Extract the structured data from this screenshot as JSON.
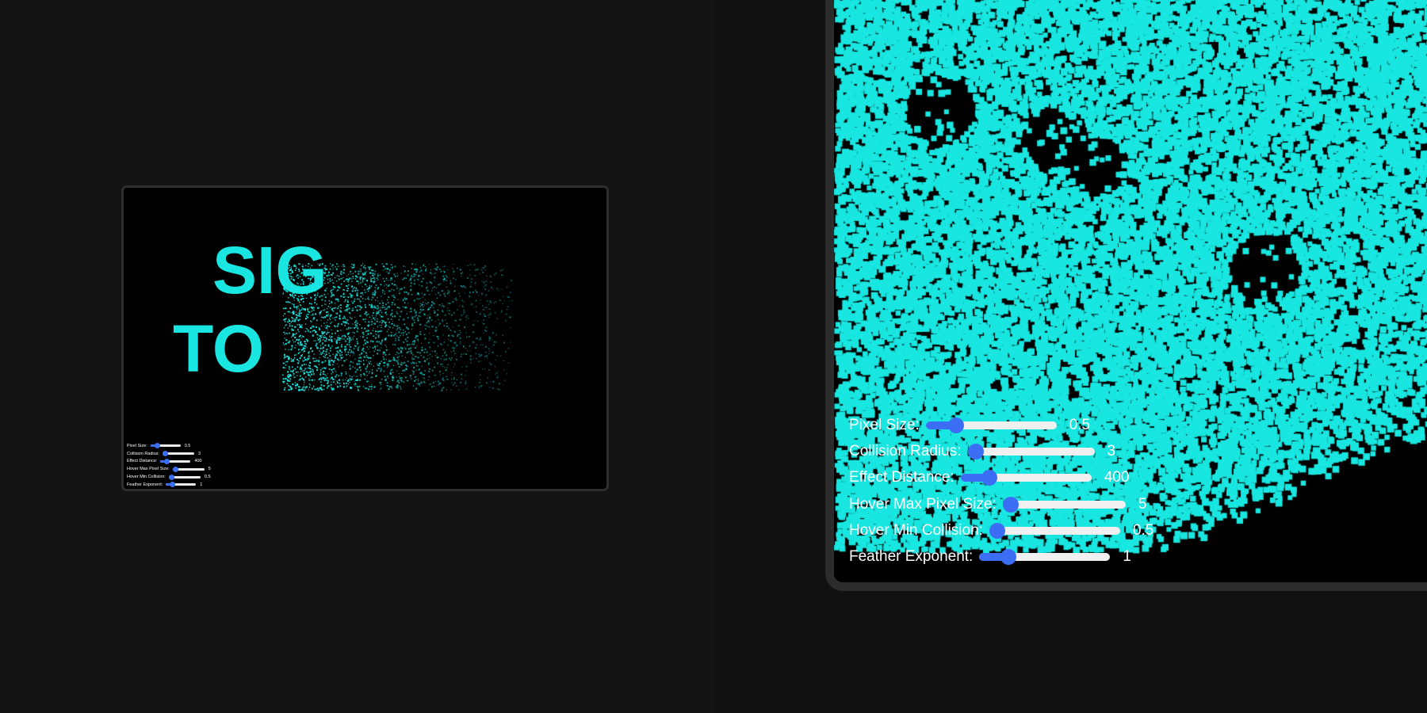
{
  "thumbnail": {
    "headline_lines": [
      "SIG",
      "TO"
    ],
    "particle_color": "#19e6e0"
  },
  "zoom": {
    "particle_color": "#19e6e0"
  },
  "accent_color": "#3b6ef5",
  "controls": [
    {
      "label": "Pixel Size:",
      "value": "0.5",
      "fraction": 0.23
    },
    {
      "label": "Collision Radius:",
      "value": "3",
      "fraction": 0.05
    },
    {
      "label": "Effect Distance:",
      "value": "400",
      "fraction": 0.22
    },
    {
      "label": "Hover Max Pixel Size:",
      "value": "5",
      "fraction": 0.0
    },
    {
      "label": "Hover Min Collision:",
      "value": "0.5",
      "fraction": 0.06
    },
    {
      "label": "Feather Exponent:",
      "value": "1",
      "fraction": 0.22
    }
  ]
}
